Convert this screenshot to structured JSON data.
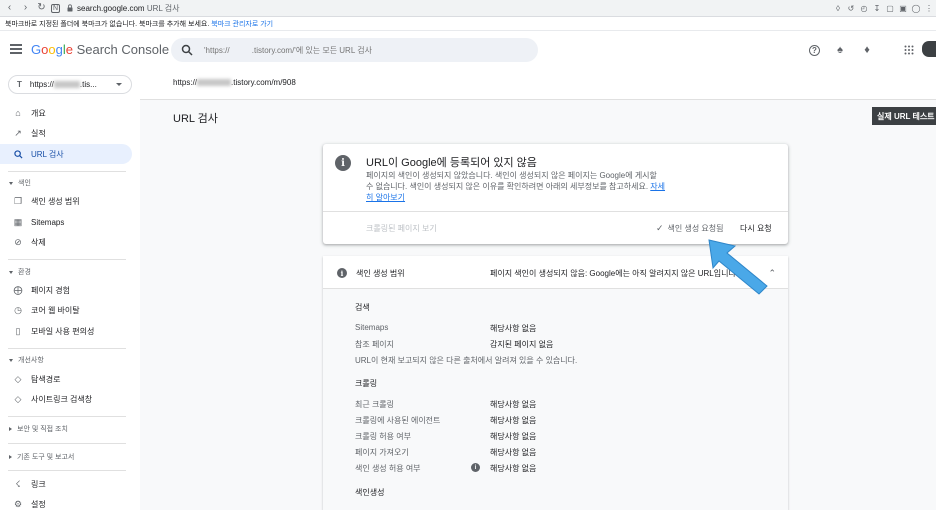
{
  "browser": {
    "url_host": "search.google.com",
    "url_path": "URL 검사",
    "bookmark_message": "북마크바로 지정된 폴더에 북마크가 없습니다. 북마크를 추가해 보세요.",
    "bookmark_link": "북마크 관리자로 가기"
  },
  "header": {
    "logo_g": "G",
    "logo_o1": "o",
    "logo_o2": "o",
    "logo_g2": "g",
    "logo_l": "l",
    "logo_e": "e",
    "logo_rest": " Search Console",
    "search_placeholder": "'https://          .tistory.com/'에 있는 모든 URL 검사"
  },
  "sidebar": {
    "property_prefix": "https://",
    "property_suffix": ".tis...",
    "items": [
      {
        "label": "개요",
        "icon": "home-icon"
      },
      {
        "label": "실적",
        "icon": "trending-up-icon"
      },
      {
        "label": "URL 검사",
        "icon": "search-icon"
      },
      {
        "label": "색인 생성 범위",
        "icon": "file-copy-icon"
      },
      {
        "label": "Sitemaps",
        "icon": "sitemap-icon"
      },
      {
        "label": "삭제",
        "icon": "visibility-off-icon"
      },
      {
        "label": "페이지 경험",
        "icon": "plus-circle-icon"
      },
      {
        "label": "코어 웹 바이탈",
        "icon": "speed-icon"
      },
      {
        "label": "모바일 사용 편의성",
        "icon": "phone-icon"
      },
      {
        "label": "탐색경로",
        "icon": "layers-icon"
      },
      {
        "label": "사이트링크 검색창",
        "icon": "layers-icon"
      },
      {
        "label": "링크",
        "icon": "network-icon"
      },
      {
        "label": "설정",
        "icon": "settings-icon"
      }
    ],
    "sections": {
      "index": "색인",
      "experience": "환경",
      "enhancements": "개선사항",
      "security": "보안 및 직접 조치",
      "legacy": "기존 도구 및 보고서"
    }
  },
  "main": {
    "breadcrumb_prefix": "https://",
    "breadcrumb_suffix": ".tistory.com/m/908",
    "page_title": "URL 검사",
    "live_test": "실제 URL 테스트"
  },
  "status_card": {
    "title": "URL이 Google에 등록되어 있지 않음",
    "desc": "페이지의 색인이 생성되지 않았습니다. 색인이 생성되지 않은 페이지는 Google에 게시할 수 없습니다. 색인이 생성되지 않은 이유를 확인하려면 아래의 세부정보를 참고하세요.",
    "learn_more": "자세히 알아보기",
    "view_crawled": "크롤링된 페이지 보기",
    "requested": "색인 생성 요청됨",
    "retry": "다시 요청"
  },
  "coverage": {
    "label": "색인 생성 범위",
    "status": "페이지 색인이 생성되지 않음: Google에는 아직 알려지지 않은 URL입니다",
    "discovery_heading": "검색",
    "sitemaps_label": "Sitemaps",
    "sitemaps_value": "해당사항 없음",
    "referring_label": "참조 페이지",
    "referring_value": "감지된 페이지 없음",
    "discovery_note": "URL이 현재 보고되지 않은 다른 출처에서 알려져 있을 수 있습니다.",
    "crawl_heading": "크롤링",
    "last_crawl_label": "최근 크롤링",
    "last_crawl_value": "해당사항 없음",
    "agent_label": "크롤링에 사용된 에이전트",
    "agent_value": "해당사항 없음",
    "crawl_allowed_label": "크롤링 허용 여부",
    "crawl_allowed_value": "해당사항 없음",
    "fetch_label": "페이지 가져오기",
    "fetch_value": "해당사항 없음",
    "index_allowed_label": "색인 생성 허용 여부",
    "index_allowed_value": "해당사항 없음",
    "indexing_heading": "색인생성"
  },
  "colors": {
    "accent": "#1a73e8",
    "active_nav": "#e8f0fe",
    "arrow": "#4aa8e8"
  }
}
